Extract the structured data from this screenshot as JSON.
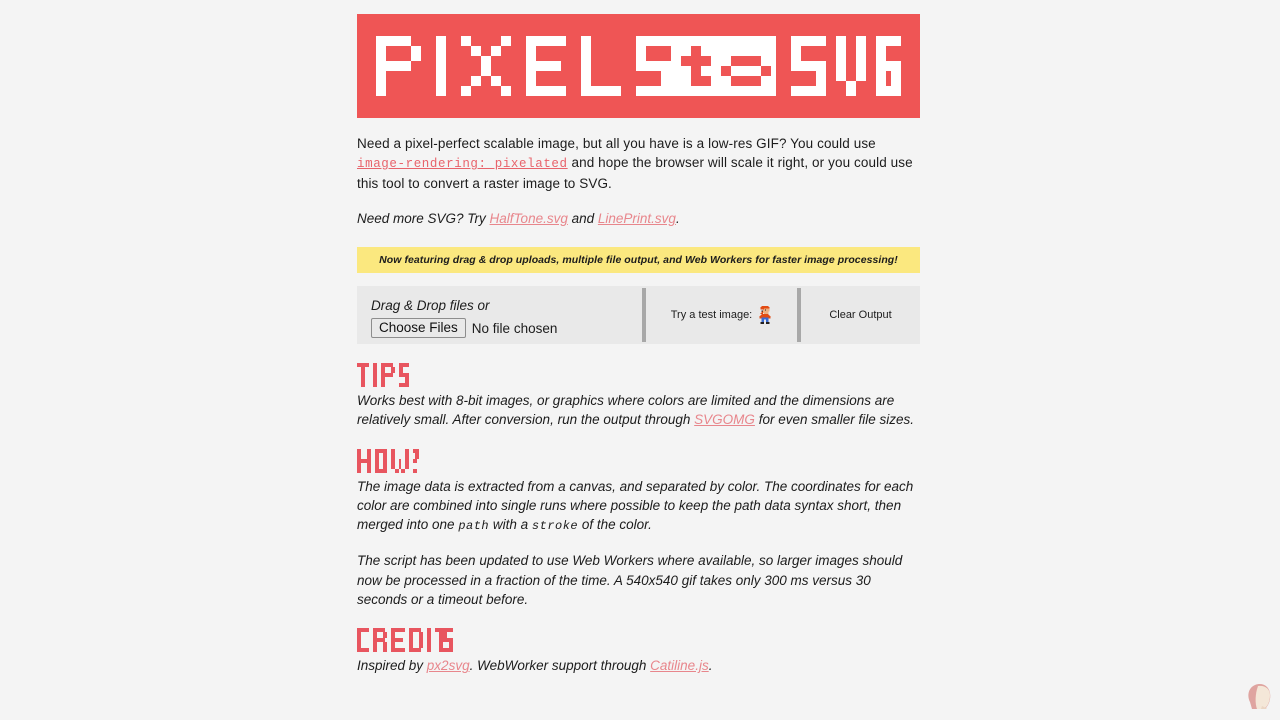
{
  "site": {
    "logo_text": "PIXELS to SVG",
    "logo_part_1": "PIXELS",
    "logo_part_2": "to",
    "logo_part_3": "SVG",
    "brand_color": "#ef5555",
    "page_background": "#f4f4f4"
  },
  "intro": {
    "text_before_code": "Need a pixel-perfect scalable image, but all you have is a low-res GIF? You could use ",
    "code": "image-rendering: pixelated",
    "text_after_code": " and hope the browser will scale it right, or you could use this tool to convert a raster image to SVG.",
    "more_svg_prefix": "Need more SVG? Try ",
    "more_svg_link_1": "HalfTone.svg",
    "more_svg_middle": " and ",
    "more_svg_link_2": "LinePrint.svg",
    "more_svg_suffix": "."
  },
  "notice": {
    "text": "Now featuring drag & drop uploads, multiple file output, and Web Workers for faster image processing!",
    "background": "#fbe87f"
  },
  "controls": {
    "drop_label": "Drag & Drop files or",
    "choose_files_label": "Choose Files",
    "no_file_label": "No file chosen",
    "test_image_label": "Try a test image:",
    "test_image_icon": "mario-sprite-icon",
    "clear_output_label": "Clear Output",
    "background": "#e9e9e9",
    "divider_color": "#a8a8a8"
  },
  "sections": {
    "tips": {
      "heading": "TIPS",
      "body_1": "Works best with 8-bit images, or graphics where colors are limited and the dimensions are relatively small. After conversion, run the output through ",
      "link": "SVGOMG",
      "body_2": " for even smaller file sizes."
    },
    "how": {
      "heading": "HOW?",
      "p1_a": "The image data is extracted from a canvas, and separated by color. The coordinates for each color are combined into single runs where possible to keep the path data syntax short, then merged into one ",
      "p1_code_1": "path",
      "p1_b": " with a ",
      "p1_code_2": "stroke",
      "p1_c": " of the color.",
      "p2": "The script has been updated to use Web Workers where available, so larger images should now be processed in a fraction of the time. A 540x540 gif takes only 300 ms versus 30 seconds or a timeout before."
    },
    "credits": {
      "heading": "CREDITS",
      "body_prefix": "Inspired by ",
      "link_1": "px2svg",
      "body_middle": ". WebWorker support through ",
      "link_2": "Catiline.js",
      "body_suffix": "."
    }
  },
  "corner": {
    "avatar_name": "profile-avatar-icon"
  }
}
